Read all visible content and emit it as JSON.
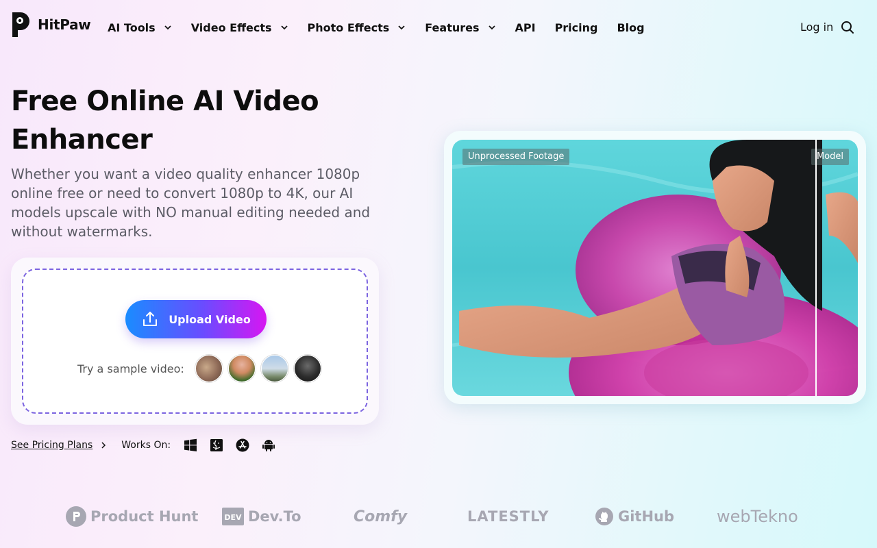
{
  "header": {
    "brand": "HitPaw",
    "nav": [
      {
        "label": "AI Tools",
        "dropdown": true
      },
      {
        "label": "Video Effects",
        "dropdown": true
      },
      {
        "label": "Photo Effects",
        "dropdown": true
      },
      {
        "label": "Features",
        "dropdown": true
      },
      {
        "label": "API",
        "dropdown": false
      },
      {
        "label": "Pricing",
        "dropdown": false
      },
      {
        "label": "Blog",
        "dropdown": false
      }
    ],
    "login_label": "Log in",
    "search_icon": "search-icon"
  },
  "hero": {
    "title_line1": "Free Online AI Video",
    "title_line2": "Enhancer",
    "subtitle": "Whether you want a video quality enhancer 1080p online free or need to convert 1080p to 4K, our AI models upscale with NO manual editing needed and without watermarks.",
    "upload_label": "Upload Video",
    "sample_label": "Try a sample video:",
    "pricing_link": "See Pricing Plans",
    "works_on_label": "Works On:",
    "platforms": [
      "windows-icon",
      "mac-icon",
      "app-store-icon",
      "android-icon"
    ]
  },
  "compare": {
    "left_label": "Unprocessed Footage",
    "right_label": "Model"
  },
  "brands": [
    "Product Hunt",
    "Dev.To",
    "Comfy",
    "LATESTLY",
    "GitHub",
    "webTekno"
  ],
  "colors": {
    "accent_start": "#1a8cff",
    "accent_mid": "#6a4cff",
    "accent_end": "#d716f2",
    "dash_border": "#7b63e0",
    "brand_gray": "#a7a7b2"
  }
}
